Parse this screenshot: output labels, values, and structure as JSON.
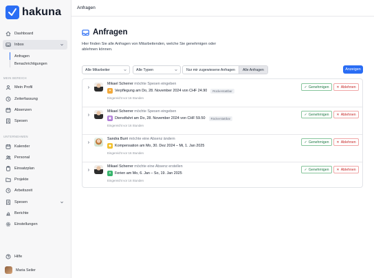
{
  "app": {
    "name": "hakuna",
    "brand_color": "#2a6df4"
  },
  "topbar": {
    "title": "Anfragen"
  },
  "sidebar": {
    "items": [
      {
        "label": "Dashboard",
        "icon": "home-icon"
      },
      {
        "label": "Inbox",
        "icon": "inbox-icon"
      }
    ],
    "inbox_sub": [
      {
        "label": "Anfragen"
      },
      {
        "label": "Benachrichtigungen"
      }
    ],
    "section_mein_bereich": "MEIN BEREICH",
    "mein_bereich": [
      {
        "label": "Mein Profil",
        "icon": "user-icon"
      },
      {
        "label": "Zeiterfassung",
        "icon": "clock-icon"
      },
      {
        "label": "Absenzen",
        "icon": "calendar-icon"
      },
      {
        "label": "Spesen",
        "icon": "receipt-icon"
      }
    ],
    "section_unternehmen": "UNTERNEHMEN",
    "unternehmen": [
      {
        "label": "Kalender",
        "icon": "calendar-icon"
      },
      {
        "label": "Personal",
        "icon": "people-icon"
      },
      {
        "label": "Einsatzplan",
        "icon": "clipboard-icon"
      },
      {
        "label": "Projekte",
        "icon": "folder-icon"
      },
      {
        "label": "Arbeitszeit",
        "icon": "clock-icon"
      },
      {
        "label": "Spesen",
        "icon": "receipt-icon"
      },
      {
        "label": "Berichte",
        "icon": "chart-icon"
      },
      {
        "label": "Einstellungen",
        "icon": "gear-icon"
      }
    ],
    "help": "Hilfe",
    "user": "Maria Seiler"
  },
  "page": {
    "title": "Anfragen",
    "description": "Hier finden Sie alle Anfragen von Mitarbeitenden, welche Sie genehmigen oder ablehnen können."
  },
  "filters": {
    "employee": "Alle Mitarbeiter",
    "type": "Alle Typen",
    "seg_assigned": "Nur mir zugewiesene Anfragen",
    "seg_all": "Alle Anfragen",
    "apply": "Anzeigen"
  },
  "actions": {
    "approve": "Genehmigen",
    "reject": "Ablehnen"
  },
  "requests": [
    {
      "name": "Mikael Scherrer",
      "verb": "möchte Spesen eingeben",
      "detail": "Verpflegung am Do, 28. November 2024 von CHF 24.90",
      "badge": "Rückerstattbar",
      "submitted": "Eingereicht vor 16 Stunden",
      "icon_color": "#f2a93b"
    },
    {
      "name": "Mikael Scherrer",
      "verb": "möchte Spesen eingeben",
      "detail": "Dienstfahrt am Do, 28. November 2024 von CHF 59.50",
      "badge": "Rückerstattbar",
      "submitted": "Eingereicht vor 16 Stunden",
      "icon_color": "#b07cd8"
    },
    {
      "name": "Sandra Burri",
      "verb": "möchte eine Absenz ändern",
      "detail": "Kompensation am Mo, 30. Dez 2024 – Mi, 1. Jan 2025",
      "badge": "",
      "submitted": "Eingereicht vor 16 Stunden",
      "icon_color": "#f2c12e"
    },
    {
      "name": "Mikael Scherrer",
      "verb": "möchte eine Absenz erstellen",
      "detail": "Ferien am Mo, 6. Jan – So, 19. Jan 2025",
      "badge": "",
      "submitted": "Eingereicht vor 16 Stunden",
      "icon_color": "#34b36a"
    }
  ]
}
